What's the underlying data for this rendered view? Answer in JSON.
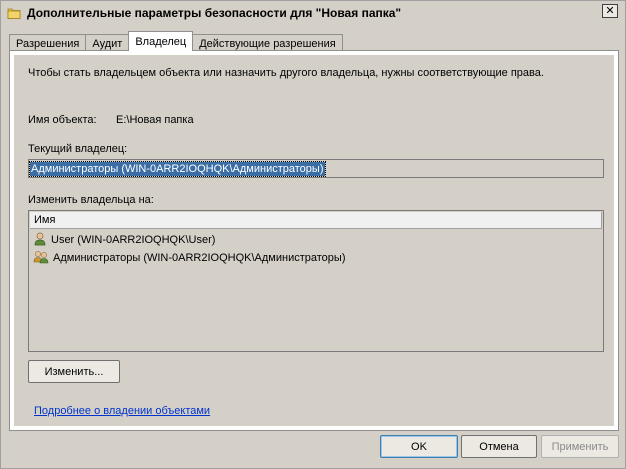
{
  "window": {
    "title": "Дополнительные параметры безопасности  для \"Новая папка\"",
    "close_glyph": "✕"
  },
  "tabs": [
    {
      "label": "Разрешения",
      "active": false
    },
    {
      "label": "Аудит",
      "active": false
    },
    {
      "label": "Владелец",
      "active": true
    },
    {
      "label": "Действующие разрешения",
      "active": false
    }
  ],
  "owner_tab": {
    "intro": "Чтобы стать владельцем объекта или назначить другого владельца, нужны соответствующие права.",
    "object_name_label": "Имя объекта:",
    "object_name_value": "E:\\Новая папка",
    "current_owner_label": "Текущий владелец:",
    "current_owner_value": "Администраторы (WIN-0ARR2IOQHQK\\Администраторы)",
    "change_owner_label": "Изменить владельца на:",
    "list_column_header": "Имя",
    "owners": [
      {
        "label": "User (WIN-0ARR2IOQHQK\\User)",
        "icon": "user-icon"
      },
      {
        "label": "Администраторы (WIN-0ARR2IOQHQK\\Администраторы)",
        "icon": "group-icon"
      }
    ],
    "change_button": "Изменить...",
    "learn_more_link": "Подробнее о владении объектами"
  },
  "footer": {
    "ok_label": "OK",
    "cancel_label": "Отмена",
    "apply_label": "Применить"
  },
  "colors": {
    "selection": "#3a6ea5",
    "link": "#0033cc",
    "dialog_bg": "#d4d0c8"
  }
}
